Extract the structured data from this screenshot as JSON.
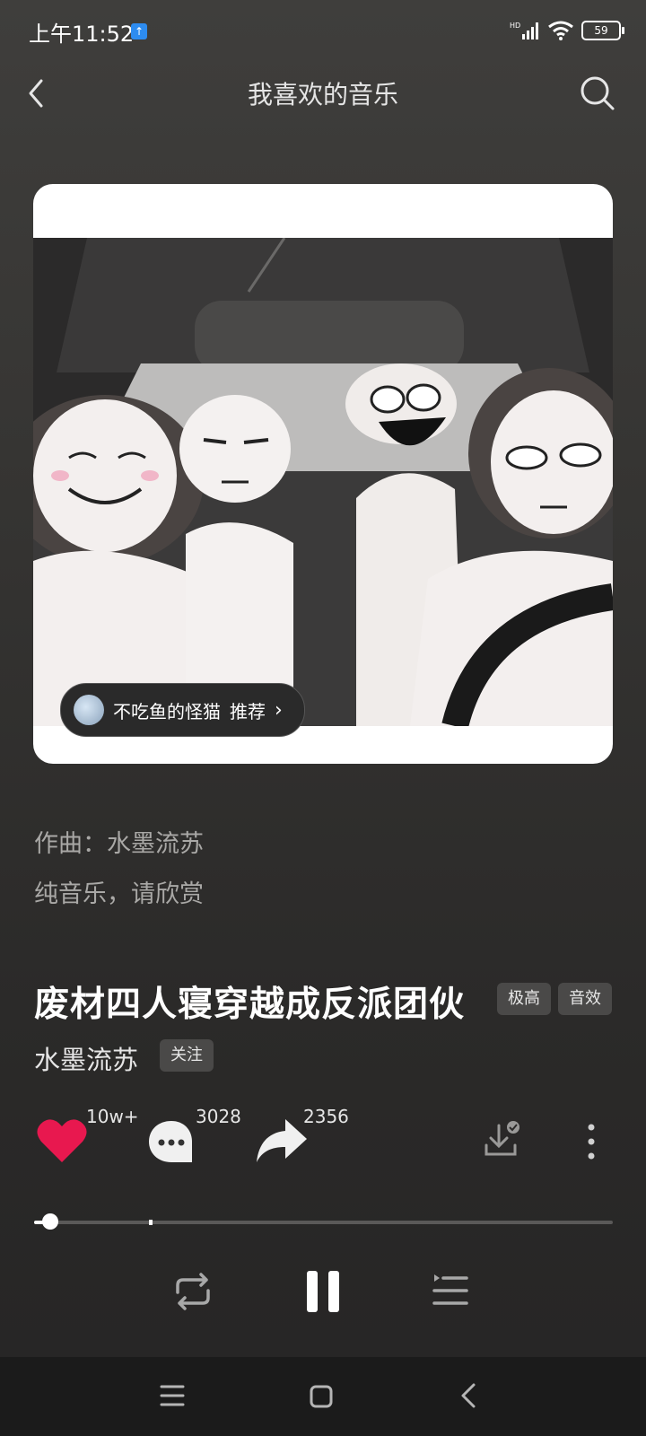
{
  "status_bar": {
    "time": "上午11:52",
    "battery": "59",
    "network": "HD"
  },
  "header": {
    "title": "我喜欢的音乐"
  },
  "cover": {
    "recommender": "不吃鱼的怪猫",
    "recommend_label": "推荐"
  },
  "lyrics": [
    "作曲：水墨流苏",
    "纯音乐，请欣赏"
  ],
  "song": {
    "title": "废材四人寝穿越成反派团伙",
    "tags": [
      "极高",
      "音效"
    ],
    "artist": "水墨流苏",
    "follow_label": "关注"
  },
  "actions": {
    "likes": "10w+",
    "comments": "3028",
    "shares": "2356"
  },
  "player": {
    "progress": 0.02,
    "buffered": 0.2
  },
  "colors": {
    "like": "#e8184f",
    "background": "#353432"
  }
}
